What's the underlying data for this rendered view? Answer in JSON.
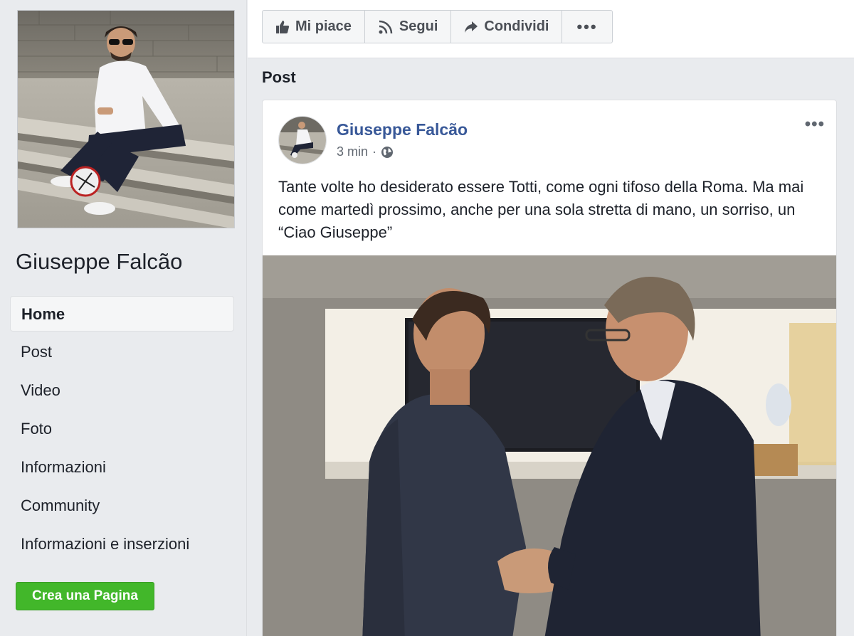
{
  "sidebar": {
    "profile_name": "Giuseppe Falcão",
    "nav": [
      {
        "label": "Home",
        "active": true
      },
      {
        "label": "Post"
      },
      {
        "label": "Video"
      },
      {
        "label": "Foto"
      },
      {
        "label": "Informazioni"
      },
      {
        "label": "Community"
      },
      {
        "label": "Informazioni e inserzioni"
      }
    ],
    "create_page_label": "Crea una Pagina"
  },
  "toolbar": {
    "like_label": "Mi piace",
    "follow_label": "Segui",
    "share_label": "Condividi",
    "more_label": "•••"
  },
  "main": {
    "section_title": "Post"
  },
  "post": {
    "author": "Giuseppe Falcão",
    "time": "3 min",
    "separator": "·",
    "menu_label": "•••",
    "text": "Tante volte ho desiderato essere Totti, come ogni tifoso della Roma. Ma mai come martedì prossimo, anche per una sola stretta di mano, un sorriso, un “Ciao Giuseppe”"
  },
  "icons": {
    "like": "thumbs-up-icon",
    "follow": "rss-icon",
    "share": "share-arrow-icon",
    "privacy": "globe-icon"
  },
  "colors": {
    "link_blue": "#385898",
    "create_green": "#42b72a",
    "background": "#e9ebee"
  }
}
